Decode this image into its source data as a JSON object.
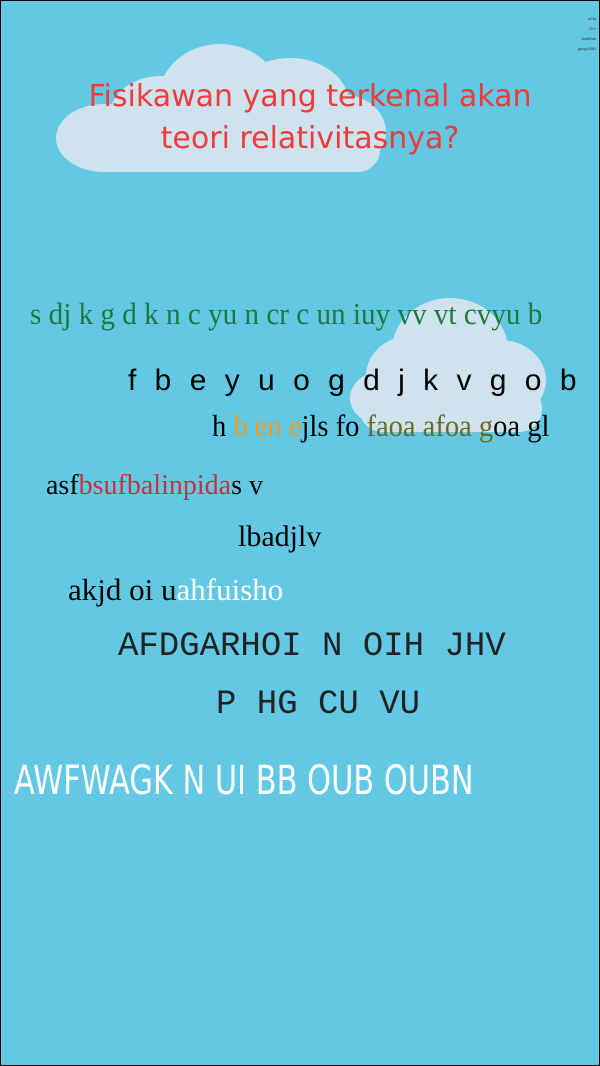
{
  "colors": {
    "background": "#62c8e4",
    "cloud_fill": "#cfe3ee",
    "title": "#ee3c3c",
    "green": "#1e7a3a",
    "orange": "#f39a21",
    "olive": "#6b6a1e",
    "red": "#c8323c",
    "white": "#ffffff",
    "black": "#000000"
  },
  "notes": [
    "oClo",
    "GrY",
    "todiBink",
    "goog.SAD"
  ],
  "title": {
    "line1": "Fisikawan yang terkenal akan",
    "line2": "teori relativitasnya?"
  },
  "lines": {
    "l1": "s dj k g d k n c yu n  cr c un iuy vv  vt cvyu b",
    "l2": "f b e y  u o g d j k v g o b",
    "l3": {
      "a": "h ",
      "b": "b ",
      "c": "en e",
      "d": "jls fo ",
      "e": "faoa afoa g",
      "f": "oa gl"
    },
    "l4": {
      "a": "asf",
      "b": "bsufbalinpida",
      "c": "s v"
    },
    "l5": "lbadjlv",
    "l6": {
      "a": "akjd  oi u",
      "b": "ahfuisho"
    },
    "l7": "AFDGARHOI N OIH JHV",
    "l8": "P HG CU VU",
    "l9": "AWFWAGK N UI BB OUB OUBN"
  }
}
